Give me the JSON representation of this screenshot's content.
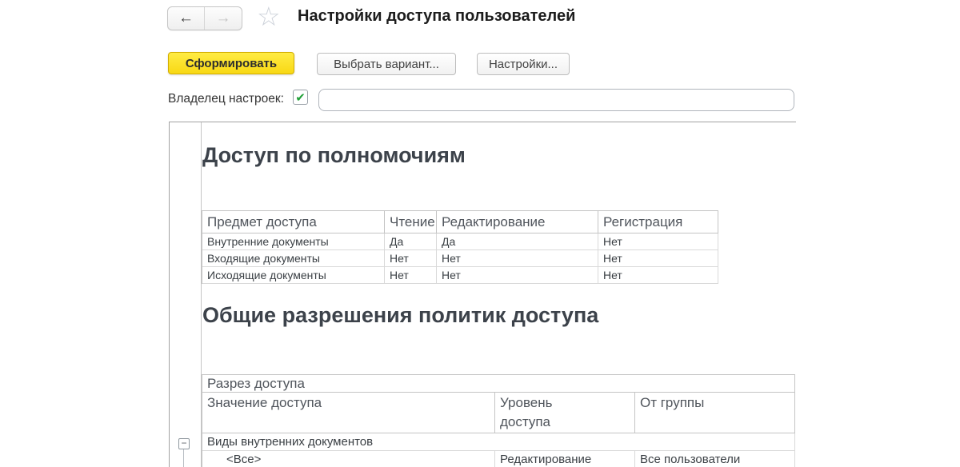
{
  "header": {
    "title": "Настройки доступа пользователей"
  },
  "icons": {
    "back": "←",
    "forward": "→",
    "star": "☆",
    "check": "✔",
    "collapse": "−"
  },
  "toolbar": {
    "generate": "Сформировать",
    "choose_variant": "Выбрать вариант...",
    "settings": "Настройки..."
  },
  "owner": {
    "label": "Владелец настроек:",
    "value": "",
    "checked": true
  },
  "sections": [
    {
      "title": "Доступ по полномочиям",
      "headers": [
        "Предмет доступа",
        "Чтение",
        "Редактирование",
        "Регистрация"
      ],
      "rows": [
        [
          "Внутренние документы",
          "Да",
          "Да",
          "Нет"
        ],
        [
          "Входящие документы",
          "Нет",
          "Нет",
          "Нет"
        ],
        [
          "Исходящие документы",
          "Нет",
          "Нет",
          "Нет"
        ]
      ]
    },
    {
      "title": "Общие разрешения политик доступа",
      "span_header": "Разрез доступа",
      "headers": [
        "Значение доступа",
        "Уровень\nдоступа",
        "От группы"
      ],
      "group_row": "Виды внутренних документов",
      "rows": [
        [
          "<Все>",
          "Редактирование",
          "Все пользователи"
        ]
      ]
    }
  ],
  "colors": {
    "accent_yellow": "#f8d814",
    "check_green": "#21a038",
    "border_gray": "#c4c4c4"
  }
}
